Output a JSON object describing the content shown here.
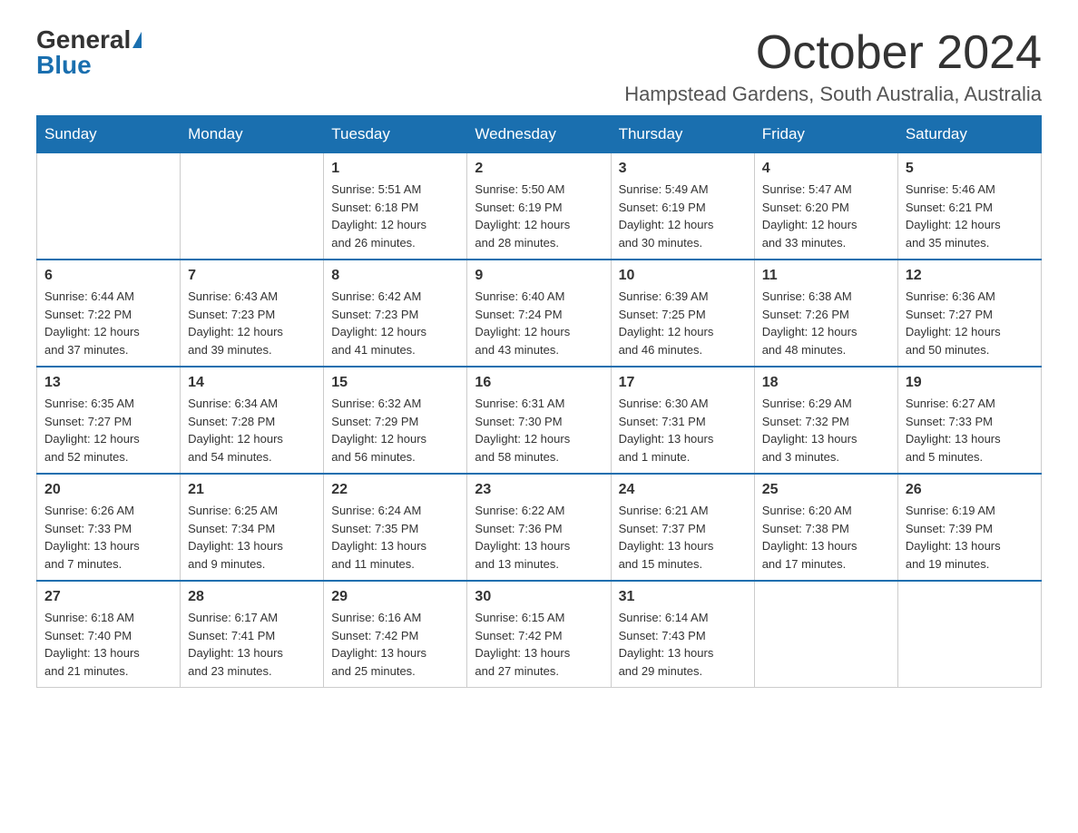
{
  "header": {
    "logo_general": "General",
    "logo_blue": "Blue",
    "month_title": "October 2024",
    "location": "Hampstead Gardens, South Australia, Australia"
  },
  "weekdays": [
    "Sunday",
    "Monday",
    "Tuesday",
    "Wednesday",
    "Thursday",
    "Friday",
    "Saturday"
  ],
  "weeks": [
    [
      {
        "day": "",
        "info": ""
      },
      {
        "day": "",
        "info": ""
      },
      {
        "day": "1",
        "info": "Sunrise: 5:51 AM\nSunset: 6:18 PM\nDaylight: 12 hours\nand 26 minutes."
      },
      {
        "day": "2",
        "info": "Sunrise: 5:50 AM\nSunset: 6:19 PM\nDaylight: 12 hours\nand 28 minutes."
      },
      {
        "day": "3",
        "info": "Sunrise: 5:49 AM\nSunset: 6:19 PM\nDaylight: 12 hours\nand 30 minutes."
      },
      {
        "day": "4",
        "info": "Sunrise: 5:47 AM\nSunset: 6:20 PM\nDaylight: 12 hours\nand 33 minutes."
      },
      {
        "day": "5",
        "info": "Sunrise: 5:46 AM\nSunset: 6:21 PM\nDaylight: 12 hours\nand 35 minutes."
      }
    ],
    [
      {
        "day": "6",
        "info": "Sunrise: 6:44 AM\nSunset: 7:22 PM\nDaylight: 12 hours\nand 37 minutes."
      },
      {
        "day": "7",
        "info": "Sunrise: 6:43 AM\nSunset: 7:23 PM\nDaylight: 12 hours\nand 39 minutes."
      },
      {
        "day": "8",
        "info": "Sunrise: 6:42 AM\nSunset: 7:23 PM\nDaylight: 12 hours\nand 41 minutes."
      },
      {
        "day": "9",
        "info": "Sunrise: 6:40 AM\nSunset: 7:24 PM\nDaylight: 12 hours\nand 43 minutes."
      },
      {
        "day": "10",
        "info": "Sunrise: 6:39 AM\nSunset: 7:25 PM\nDaylight: 12 hours\nand 46 minutes."
      },
      {
        "day": "11",
        "info": "Sunrise: 6:38 AM\nSunset: 7:26 PM\nDaylight: 12 hours\nand 48 minutes."
      },
      {
        "day": "12",
        "info": "Sunrise: 6:36 AM\nSunset: 7:27 PM\nDaylight: 12 hours\nand 50 minutes."
      }
    ],
    [
      {
        "day": "13",
        "info": "Sunrise: 6:35 AM\nSunset: 7:27 PM\nDaylight: 12 hours\nand 52 minutes."
      },
      {
        "day": "14",
        "info": "Sunrise: 6:34 AM\nSunset: 7:28 PM\nDaylight: 12 hours\nand 54 minutes."
      },
      {
        "day": "15",
        "info": "Sunrise: 6:32 AM\nSunset: 7:29 PM\nDaylight: 12 hours\nand 56 minutes."
      },
      {
        "day": "16",
        "info": "Sunrise: 6:31 AM\nSunset: 7:30 PM\nDaylight: 12 hours\nand 58 minutes."
      },
      {
        "day": "17",
        "info": "Sunrise: 6:30 AM\nSunset: 7:31 PM\nDaylight: 13 hours\nand 1 minute."
      },
      {
        "day": "18",
        "info": "Sunrise: 6:29 AM\nSunset: 7:32 PM\nDaylight: 13 hours\nand 3 minutes."
      },
      {
        "day": "19",
        "info": "Sunrise: 6:27 AM\nSunset: 7:33 PM\nDaylight: 13 hours\nand 5 minutes."
      }
    ],
    [
      {
        "day": "20",
        "info": "Sunrise: 6:26 AM\nSunset: 7:33 PM\nDaylight: 13 hours\nand 7 minutes."
      },
      {
        "day": "21",
        "info": "Sunrise: 6:25 AM\nSunset: 7:34 PM\nDaylight: 13 hours\nand 9 minutes."
      },
      {
        "day": "22",
        "info": "Sunrise: 6:24 AM\nSunset: 7:35 PM\nDaylight: 13 hours\nand 11 minutes."
      },
      {
        "day": "23",
        "info": "Sunrise: 6:22 AM\nSunset: 7:36 PM\nDaylight: 13 hours\nand 13 minutes."
      },
      {
        "day": "24",
        "info": "Sunrise: 6:21 AM\nSunset: 7:37 PM\nDaylight: 13 hours\nand 15 minutes."
      },
      {
        "day": "25",
        "info": "Sunrise: 6:20 AM\nSunset: 7:38 PM\nDaylight: 13 hours\nand 17 minutes."
      },
      {
        "day": "26",
        "info": "Sunrise: 6:19 AM\nSunset: 7:39 PM\nDaylight: 13 hours\nand 19 minutes."
      }
    ],
    [
      {
        "day": "27",
        "info": "Sunrise: 6:18 AM\nSunset: 7:40 PM\nDaylight: 13 hours\nand 21 minutes."
      },
      {
        "day": "28",
        "info": "Sunrise: 6:17 AM\nSunset: 7:41 PM\nDaylight: 13 hours\nand 23 minutes."
      },
      {
        "day": "29",
        "info": "Sunrise: 6:16 AM\nSunset: 7:42 PM\nDaylight: 13 hours\nand 25 minutes."
      },
      {
        "day": "30",
        "info": "Sunrise: 6:15 AM\nSunset: 7:42 PM\nDaylight: 13 hours\nand 27 minutes."
      },
      {
        "day": "31",
        "info": "Sunrise: 6:14 AM\nSunset: 7:43 PM\nDaylight: 13 hours\nand 29 minutes."
      },
      {
        "day": "",
        "info": ""
      },
      {
        "day": "",
        "info": ""
      }
    ]
  ]
}
